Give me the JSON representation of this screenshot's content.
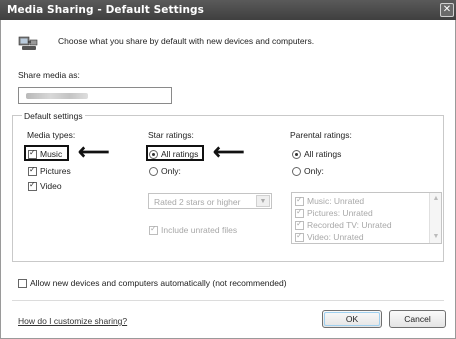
{
  "window": {
    "title": "Media Sharing - Default Settings",
    "close_glyph": "✕"
  },
  "header": {
    "text": "Choose what you share by default with new devices and computers.",
    "icon": "media-sharing-icon"
  },
  "share_media": {
    "label": "Share media as:",
    "value_obscured": true
  },
  "default_settings": {
    "legend": "Default settings",
    "media_types": {
      "label": "Media types:",
      "items": [
        {
          "label": "Music",
          "checked": true,
          "highlighted": true
        },
        {
          "label": "Pictures",
          "checked": true
        },
        {
          "label": "Video",
          "checked": true
        }
      ]
    },
    "star_ratings": {
      "label": "Star ratings:",
      "all_label": "All ratings",
      "all_selected": true,
      "all_highlighted": true,
      "only_label": "Only:",
      "dropdown_value": "Rated 2 stars or higher",
      "include_unrated_label": "Include unrated files",
      "include_unrated_checked": true
    },
    "parental_ratings": {
      "label": "Parental ratings:",
      "all_label": "All ratings",
      "all_selected": true,
      "only_label": "Only:",
      "list": [
        {
          "label": "Music: Unrated",
          "checked": true
        },
        {
          "label": "Pictures: Unrated",
          "checked": true
        },
        {
          "label": "Recorded TV: Unrated",
          "checked": true
        },
        {
          "label": "Video: Unrated",
          "checked": true
        }
      ]
    }
  },
  "allow_auto": {
    "label": "Allow new devices and computers automatically (not recommended)",
    "checked": false
  },
  "footer": {
    "help_link": "How do I customize sharing?",
    "ok_label": "OK",
    "cancel_label": "Cancel"
  },
  "annotations": {
    "arrow_glyph": "⟵"
  },
  "colors": {
    "titlebar": "#4a4a4a",
    "accent_focus": "#9fd0ef",
    "disabled_text": "#a8a8a8"
  }
}
